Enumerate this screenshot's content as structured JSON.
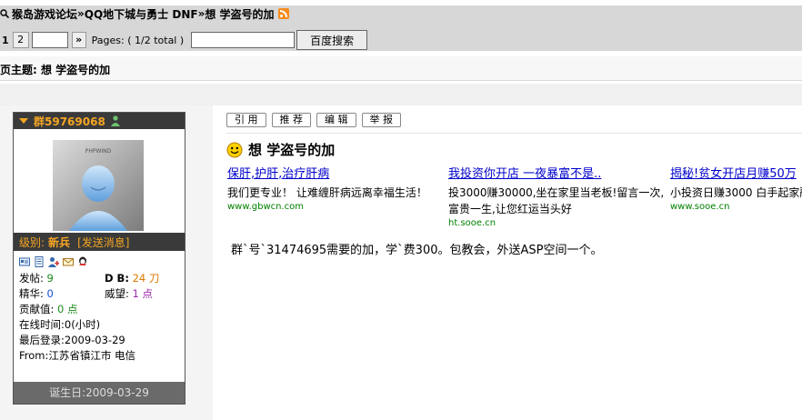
{
  "breadcrumb": {
    "forum": "猴岛游戏论坛",
    "sep1": " » ",
    "board": "QQ地下城与勇士 DNF",
    "sep2": " » ",
    "thread": "想 学盗号的加"
  },
  "pager": {
    "current": "1",
    "page2": "2",
    "next": "»",
    "info": "Pages: ( 1/2 total )",
    "search_button": "百度搜索"
  },
  "topic": {
    "title": "本页主题: 想 学盗号的加"
  },
  "user": {
    "name": "群59769068",
    "level_label": "级别:",
    "level": "新兵",
    "send_msg": "[发送消息]",
    "stats": {
      "posts_label": "发帖:",
      "posts": "9",
      "db_label": "D B:",
      "db": "24 刀",
      "elite_label": "精华:",
      "elite": "0",
      "prestige_label": "威望:",
      "prestige": "1 点",
      "contrib_label": "贡献值:",
      "contrib": "0 点",
      "online": "在线时间:0(小时)",
      "last_login": "最后登录:2009-03-29",
      "from": "From:江苏省镇江市 电信"
    },
    "birthday": "诞生日:2009-03-29"
  },
  "actions": [
    "引 用",
    "推 荐",
    "编 辑",
    "举 报"
  ],
  "post": {
    "title": "想 学盗号的加",
    "content": "群`号`31474695需要的加，学`费300。包教会，外送ASP空间一个。"
  },
  "ads": [
    {
      "title": "保肝,护肝,治疗肝病",
      "desc1": "我们更专业！  让难缠肝病远离幸福生活！",
      "desc2": "",
      "url": "www.gbwcn.com"
    },
    {
      "title": "我投资你开店 一夜暴富不是..",
      "desc1": "投3000赚30000,坐在家里当老板!留言一次,",
      "desc2": "富贵一生,让您红运当头好",
      "url": "ht.sooe.cn"
    },
    {
      "title": "揭秘!贫女开店月赚50万",
      "desc1": "小投资日赚3000 白手起家融",
      "desc2": "",
      "url": "www.sooe.cn"
    }
  ],
  "colors": {
    "panel_dark": "#3a3a3a",
    "accent_orange": "#f5a623",
    "link_blue": "#0000cc",
    "url_green": "#008000"
  }
}
